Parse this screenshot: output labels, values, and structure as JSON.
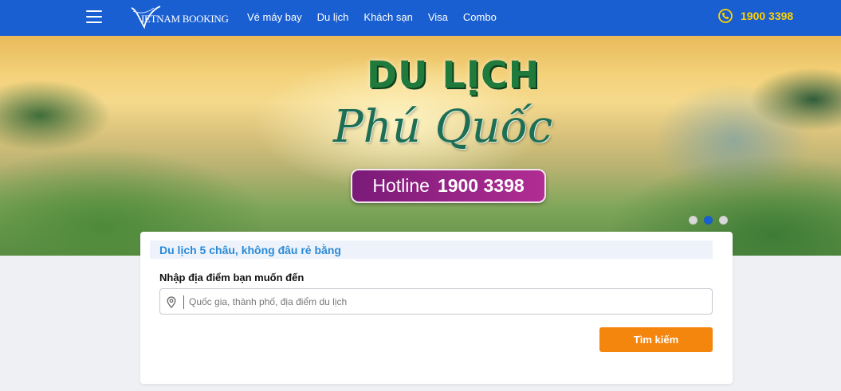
{
  "header": {
    "logo_text": "IETNAM BOOKING",
    "nav": [
      {
        "label": "Vé máy bay"
      },
      {
        "label": "Du lịch"
      },
      {
        "label": "Khách sạn"
      },
      {
        "label": "Visa"
      },
      {
        "label": "Combo"
      }
    ],
    "phone": "1900 3398",
    "icons": {
      "menu": "hamburger-icon",
      "phone": "phone-icon"
    }
  },
  "hero": {
    "title_line1": "DU LỊCH",
    "title_line2": "Phú Quốc",
    "hotline_label": "Hotline",
    "hotline_number": "1900 3398",
    "slides": {
      "total": 3,
      "active": 2
    }
  },
  "search": {
    "tagline": "Du lịch 5 châu, không đâu rẻ bằng",
    "label": "Nhập địa điểm bạn muốn đến",
    "placeholder": "Quốc gia, thành phố, địa điểm du lịch",
    "value": "",
    "button_label": "Tìm kiếm",
    "icon": "location-pin-icon"
  },
  "colors": {
    "header_bg": "#1a5fd1",
    "phone_accent": "#ffd200",
    "button": "#f4850d",
    "tagline": "#2a8ad8",
    "hotline_pill": "#9b2487"
  }
}
